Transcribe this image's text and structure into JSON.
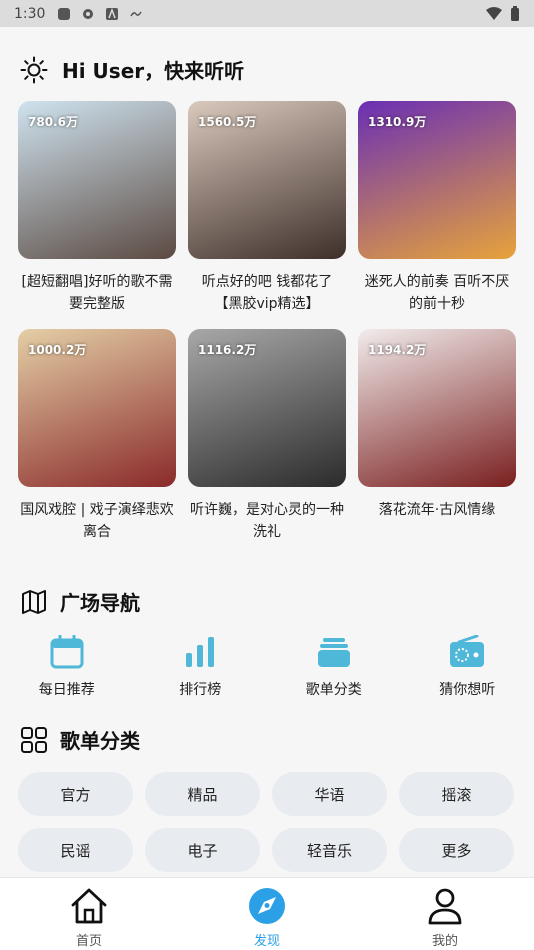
{
  "status_bar": {
    "time": "1:30"
  },
  "greeting": {
    "text": "Hi User，快来听听"
  },
  "playlists": [
    {
      "count": "780.6万",
      "title": "[超短翻唱]好听的歌不需要完整版",
      "colors": [
        "#cfe3ef",
        "#5b4a42"
      ]
    },
    {
      "count": "1560.5万",
      "title": "听点好的吧 钱都花了【黑胶vip精选】",
      "colors": [
        "#d9c9bd",
        "#3e2f2a"
      ]
    },
    {
      "count": "1310.9万",
      "title": "迷死人的前奏 百听不厌的前十秒",
      "colors": [
        "#6a2fb5",
        "#e7a33a"
      ]
    },
    {
      "count": "1000.2万",
      "title": "国风戏腔 | 戏子演绎悲欢离合",
      "colors": [
        "#e4cfa6",
        "#8a2a2a"
      ]
    },
    {
      "count": "1116.2万",
      "title": "听许巍，是对心灵的一种洗礼",
      "colors": [
        "#a8a8a8",
        "#2b2b2b"
      ]
    },
    {
      "count": "1194.2万",
      "title": "落花流年·古风情缘",
      "colors": [
        "#f2ecec",
        "#7a1f1f"
      ]
    }
  ],
  "nav_section": {
    "title": "广场导航"
  },
  "nav_items": [
    {
      "label": "每日推荐",
      "icon": "calendar-icon"
    },
    {
      "label": "排行榜",
      "icon": "bar-chart-icon"
    },
    {
      "label": "歌单分类",
      "icon": "folder-stack-icon"
    },
    {
      "label": "猜你想听",
      "icon": "radio-icon"
    }
  ],
  "category_section": {
    "title": "歌单分类"
  },
  "categories": [
    "官方",
    "精品",
    "华语",
    "摇滚",
    "民谣",
    "电子",
    "轻音乐",
    "更多"
  ],
  "tabs": [
    {
      "label": "首页",
      "icon": "home-icon"
    },
    {
      "label": "发现",
      "icon": "discover-icon"
    },
    {
      "label": "我的",
      "icon": "profile-icon"
    }
  ],
  "colors": {
    "accent": "#2ca0e6",
    "nav_icon": "#4fb8d8",
    "chip_bg": "#e8ebef"
  }
}
